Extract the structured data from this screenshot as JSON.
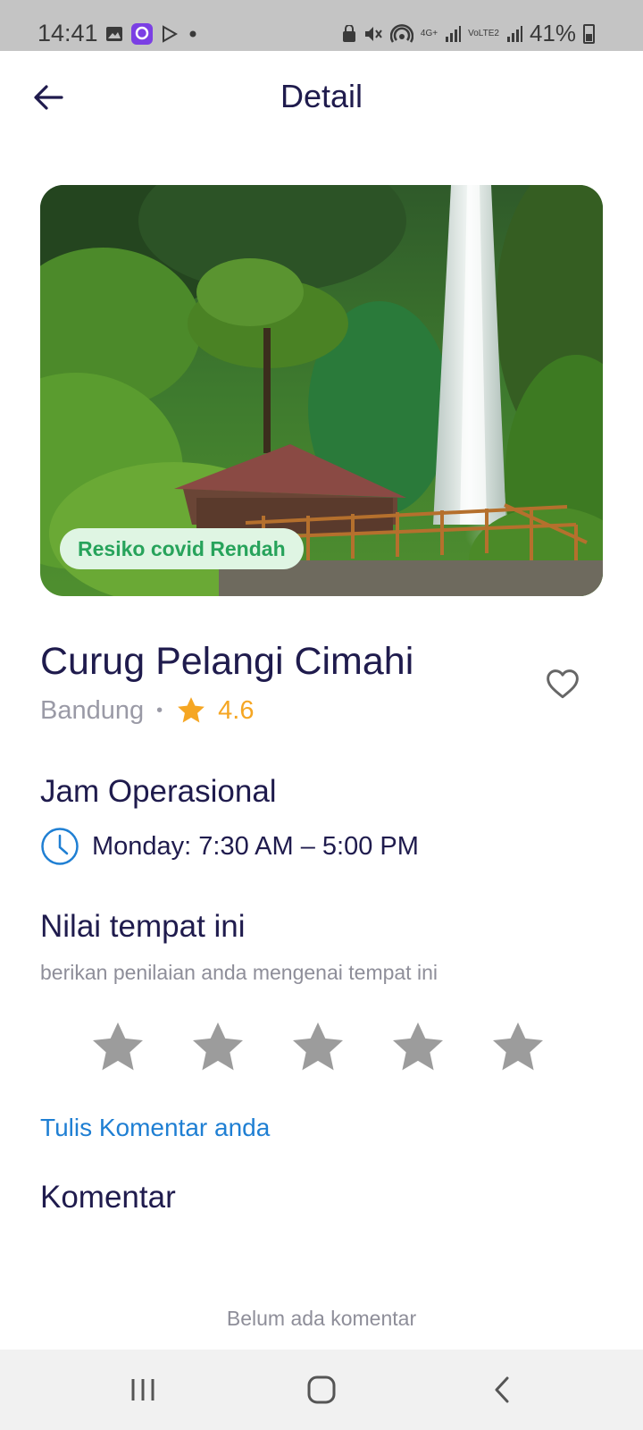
{
  "status_bar": {
    "time": "14:41",
    "network_1": "4G+",
    "network_2": "VoLTE2",
    "battery": "41%"
  },
  "header": {
    "title": "Detail",
    "back_icon": "arrow-left-icon"
  },
  "place": {
    "covid_badge": "Resiko covid Rendah",
    "name": "Curug Pelangi Cimahi",
    "city": "Bandung",
    "separator": "•",
    "rating": "4.6",
    "rating_icon": "star-icon",
    "favorite_icon": "heart-outline-icon"
  },
  "hours": {
    "title": "Jam Operasional",
    "text": "Monday: 7:30 AM – 5:00 PM",
    "icon": "clock-icon"
  },
  "rate": {
    "title": "Nilai tempat ini",
    "subtitle": "berikan penilaian anda mengenai tempat ini",
    "max_stars": 5,
    "selected": 0
  },
  "comments": {
    "write_link": "Tulis Komentar anda",
    "title": "Komentar",
    "empty_text": "Belum ada komentar"
  },
  "colors": {
    "primary_text": "#1f1b4d",
    "accent_link": "#1f7fd3",
    "star_rating": "#f5a623",
    "star_empty": "#9c9c9c",
    "badge_bg": "#dff5e3",
    "badge_text": "#27a35b"
  },
  "nav_bar": {
    "recent_icon": "recent-apps-icon",
    "home_icon": "home-icon",
    "back_icon": "back-chevron-icon"
  }
}
